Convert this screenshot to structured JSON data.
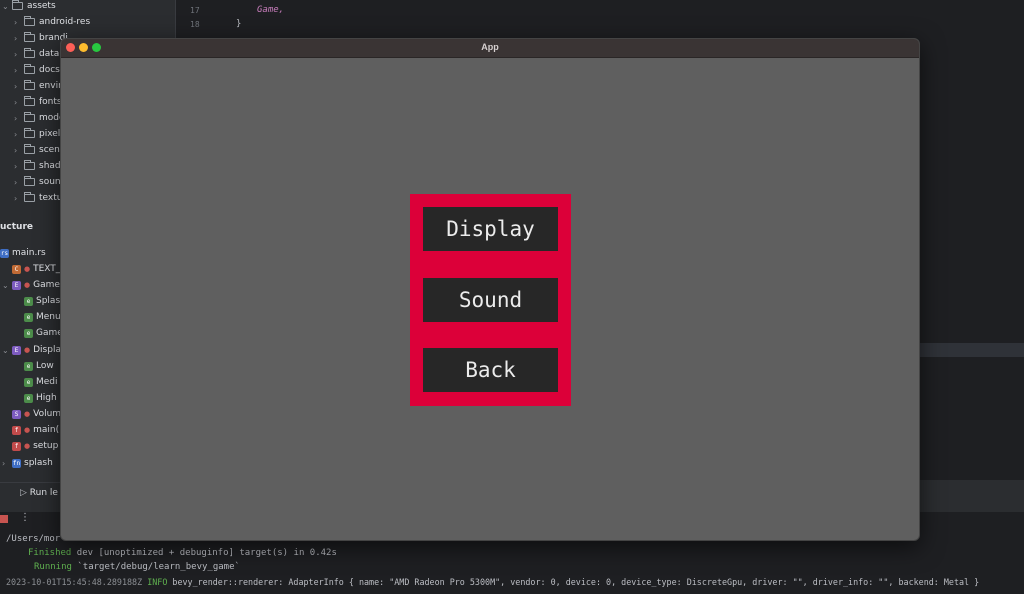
{
  "project_tree": {
    "root": "assets",
    "items": [
      "android-res",
      "brandi",
      "data",
      "docs",
      "envir",
      "fonts",
      "mode",
      "pixel",
      "scen",
      "shad",
      "soun",
      "textu"
    ]
  },
  "structure": {
    "title": "ucture",
    "file": "main.rs",
    "items": [
      {
        "badge": "C",
        "label": "TEXT_"
      },
      {
        "badge": "E",
        "label": "Game"
      },
      {
        "badge": "e",
        "label": "Splas"
      },
      {
        "badge": "e",
        "label": "Menu"
      },
      {
        "badge": "e",
        "label": "Game"
      },
      {
        "badge": "E",
        "label": "Displa"
      },
      {
        "badge": "e",
        "label": "Low"
      },
      {
        "badge": "e",
        "label": "Medi"
      },
      {
        "badge": "e",
        "label": "High"
      },
      {
        "badge": "S",
        "label": "Volum"
      },
      {
        "badge": "f",
        "label": "main("
      },
      {
        "badge": "f",
        "label": "setup"
      },
      {
        "badge": "fn",
        "label": "splash"
      }
    ]
  },
  "editor": {
    "lines": [
      {
        "num": "17",
        "text": "Game,"
      },
      {
        "num": "18",
        "text": "}"
      }
    ]
  },
  "run": {
    "tab_label": "Run le",
    "more": "⋮"
  },
  "console": {
    "path": "/Users/mor",
    "finished_label": "Finished",
    "finished_text": "dev [unoptimized + debuginfo] target(s) in 0.42s",
    "running_label": "Running",
    "running_text": "`target/debug/learn_bevy_game`",
    "log_time": "2023-10-01T15:45:48.289188Z",
    "log_level": "INFO",
    "log_text": "bevy_render::renderer: AdapterInfo { name: \"AMD Radeon Pro 5300M\", vendor: 0, device: 0, device_type: DiscreteGpu, driver: \"\", driver_info: \"\", backend: Metal }"
  },
  "app_window": {
    "title": "App",
    "buttons": {
      "display": "Display",
      "sound": "Sound",
      "back": "Back"
    }
  },
  "colors": {
    "menu_panel": "#dc0039",
    "button_bg": "#272727",
    "window_bg": "#5f5f5f"
  }
}
